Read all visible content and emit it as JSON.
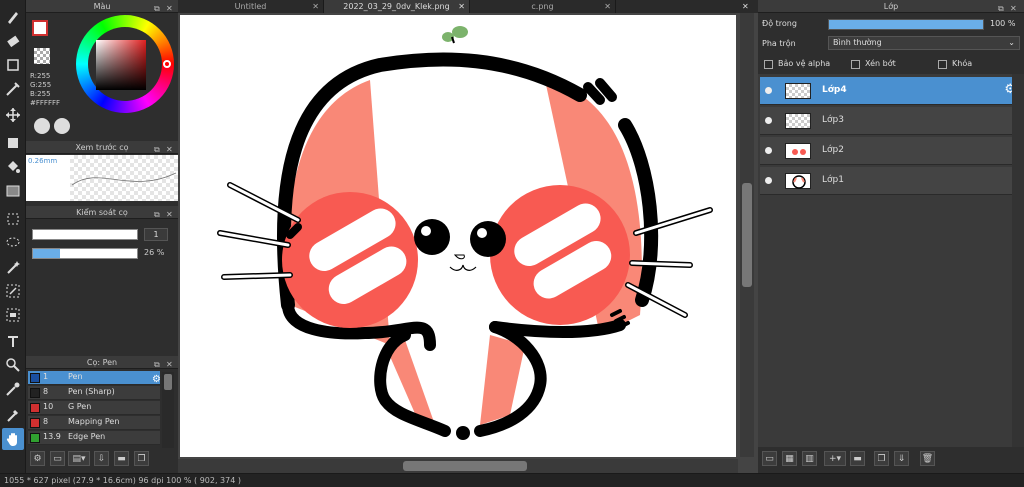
{
  "tabs": [
    "Untitled",
    "2022_03_29_0dv_Klek.png",
    "c.png"
  ],
  "color_panel": {
    "title": "Màu",
    "r": "R:255",
    "g": "G:255",
    "b": "B:255",
    "hex": "#FFFFFF"
  },
  "brush_preview": {
    "title": "Xem trước cọ",
    "size": "0.26mm"
  },
  "brush_control": {
    "title": "Kiểm soát cọ",
    "size_value": "1",
    "opacity_value": "26 %",
    "opacity_fraction": 0.26
  },
  "brush_list": {
    "title": "Cọ: Pen",
    "items": [
      {
        "size": "1",
        "name": "Pen",
        "color": "#1a4fa0"
      },
      {
        "size": "8",
        "name": "Pen (Sharp)",
        "color": "#222222"
      },
      {
        "size": "10",
        "name": "G Pen",
        "color": "#d03030"
      },
      {
        "size": "8",
        "name": "Mapping Pen",
        "color": "#d03030"
      },
      {
        "size": "13.9",
        "name": "Edge Pen",
        "color": "#30a030"
      }
    ]
  },
  "layer_panel": {
    "title": "Lớp",
    "opacity_label": "Độ trong",
    "opacity_value": "100 %",
    "opacity_fraction": 1.0,
    "blend_label": "Pha trộn",
    "blend_value": "Bình thường",
    "protect_alpha": "Bảo vệ alpha",
    "clipping": "Xén bớt",
    "lock": "Khóa",
    "layers": [
      "Lớp4",
      "Lớp3",
      "Lớp2",
      "Lớp1"
    ]
  },
  "status": {
    "text": "1055 * 627 pixel   (27.9 * 16.6cm)   96 dpi   100 %   ( 902, 374 )"
  },
  "colors": {
    "accent": "#4a90d0",
    "salmon": "#f98877",
    "red": "#f85a52",
    "leaf": "#7cb36c"
  }
}
